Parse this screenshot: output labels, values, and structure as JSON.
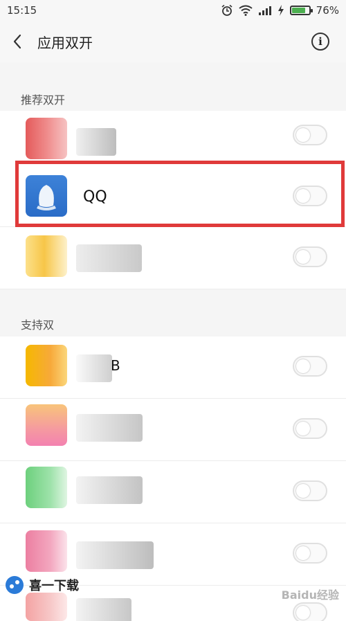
{
  "status_bar": {
    "time": "15:15",
    "battery_percent": "76%",
    "battery_level": 0.76,
    "icons": [
      "alarm-icon",
      "wifi-icon",
      "signal-icon",
      "charging-icon",
      "battery-icon"
    ]
  },
  "header": {
    "back_icon": "chevron-left-icon",
    "title": "应用双开",
    "info_icon": "info-icon",
    "info_glyph": "i"
  },
  "sections": [
    {
      "label": "推荐双开"
    },
    {
      "label": "支持双"
    }
  ],
  "recommended_apps": [
    {
      "name": "",
      "enabled": false
    },
    {
      "name": "QQ",
      "enabled": false
    },
    {
      "name": "",
      "enabled": false
    }
  ],
  "supported_apps": [
    {
      "name": "B",
      "enabled": false
    },
    {
      "name": "",
      "enabled": false
    },
    {
      "name": "",
      "enabled": false
    },
    {
      "name": "",
      "enabled": false
    },
    {
      "name": "",
      "enabled": false
    }
  ],
  "colors": {
    "highlight": "#e03a3a",
    "qq_icon": "#2a6cc7"
  },
  "watermark": {
    "left_text": "喜一下载",
    "right_text": "Baidu经验"
  }
}
